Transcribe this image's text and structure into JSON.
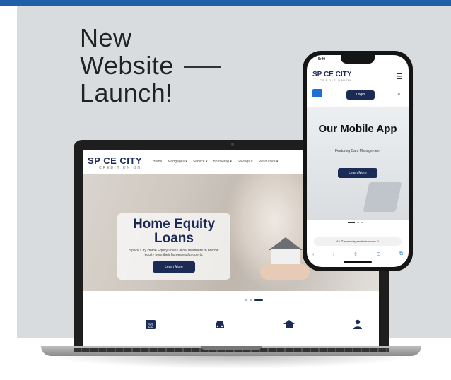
{
  "headline": {
    "line1": "New",
    "line2": "Website",
    "line3": "Launch!"
  },
  "colors": {
    "accent_bar": "#1f5fa8",
    "brand_navy": "#1b2b55",
    "panel_bg": "#d8dcdf"
  },
  "laptop_site": {
    "logo": "SP  CE CITY",
    "logo_sub": "CREDIT UNION",
    "nav": [
      "Home",
      "Mortgages ▾",
      "Service ▾",
      "Borrowing ▾",
      "Savings ▾",
      "Resources ▾"
    ],
    "hero_title": "Home Equity Loans",
    "hero_text": "Space City Home Equity Loans allow members to borrow equity from their homestead property.",
    "hero_button": "Learn More",
    "icons": [
      "calendar-icon",
      "car-icon",
      "home-loan-icon",
      "person-icon"
    ],
    "calendar_number": "22"
  },
  "phone_site": {
    "time": "5:00",
    "logo": "SP  CE CITY",
    "logo_sub": "CREDIT UNION",
    "menu": "☰",
    "login": "Login",
    "search": "⌕",
    "hero_title": "Our Mobile App",
    "hero_subtitle": "Featuring Card Management",
    "hero_button": "Learn More",
    "url": "AA  ⊡ spacecitycreditunion.com",
    "reload": "↻",
    "toolbar": [
      "‹",
      "›",
      "⇧",
      "⊡",
      "⧉"
    ]
  }
}
